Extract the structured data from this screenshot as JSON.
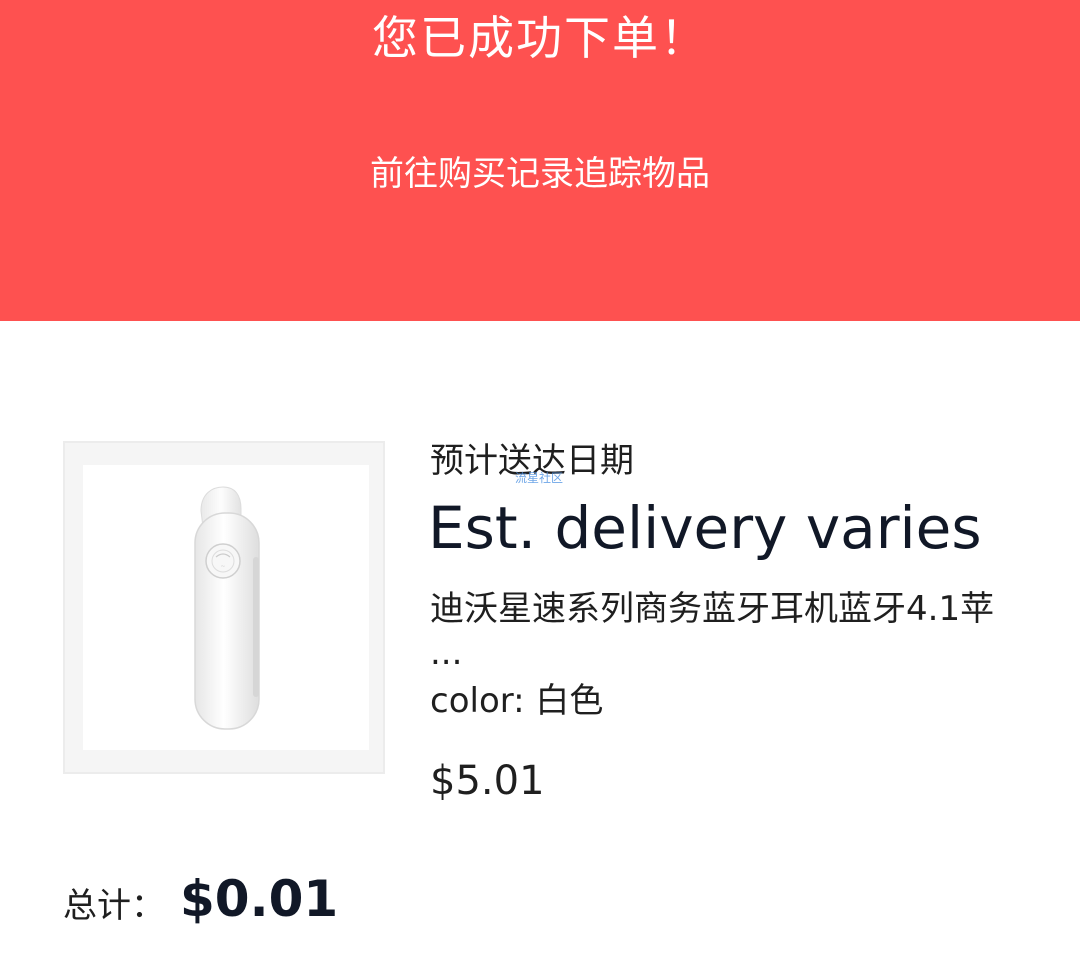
{
  "banner": {
    "title": "您已成功下单！",
    "link_text": "前往购买记录追踪物品",
    "background_color": "#fe5150"
  },
  "order_item": {
    "eta_label": "预计送达日期",
    "eta_value": "Est. delivery varies",
    "title": "迪沃星速系列商务蓝牙耳机蓝牙4.1苹",
    "title_overflow": "...",
    "variant": "color: 白色",
    "price": "$5.01",
    "image_icon": "bluetooth-earpiece",
    "watermark": "流星社区"
  },
  "summary": {
    "total_label": "总计：",
    "total_value": "$0.01"
  }
}
